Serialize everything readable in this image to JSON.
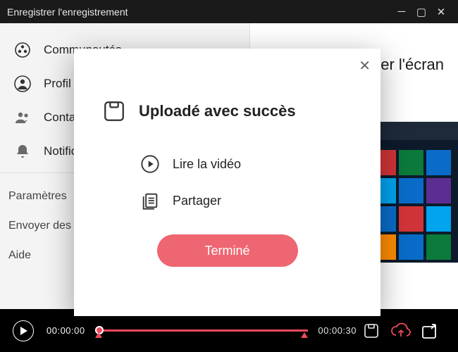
{
  "titlebar": {
    "title": "Enregistrer l'enregistrement"
  },
  "sidebar": {
    "nav": [
      {
        "label": "Communautés"
      },
      {
        "label": "Profil"
      },
      {
        "label": "Contacts"
      },
      {
        "label": "Notifications"
      }
    ],
    "settings": [
      {
        "label": "Paramètres"
      },
      {
        "label": "Envoyer des commentaires"
      },
      {
        "label": "Aide"
      }
    ]
  },
  "main": {
    "heading_fragment": "er l'écran"
  },
  "playbar": {
    "current_time": "00:00:00",
    "total_time": "00:00:30"
  },
  "modal": {
    "title": "Uploadé avec succès",
    "play_label": "Lire la vidéo",
    "share_label": "Partager",
    "done_label": "Terminé"
  }
}
